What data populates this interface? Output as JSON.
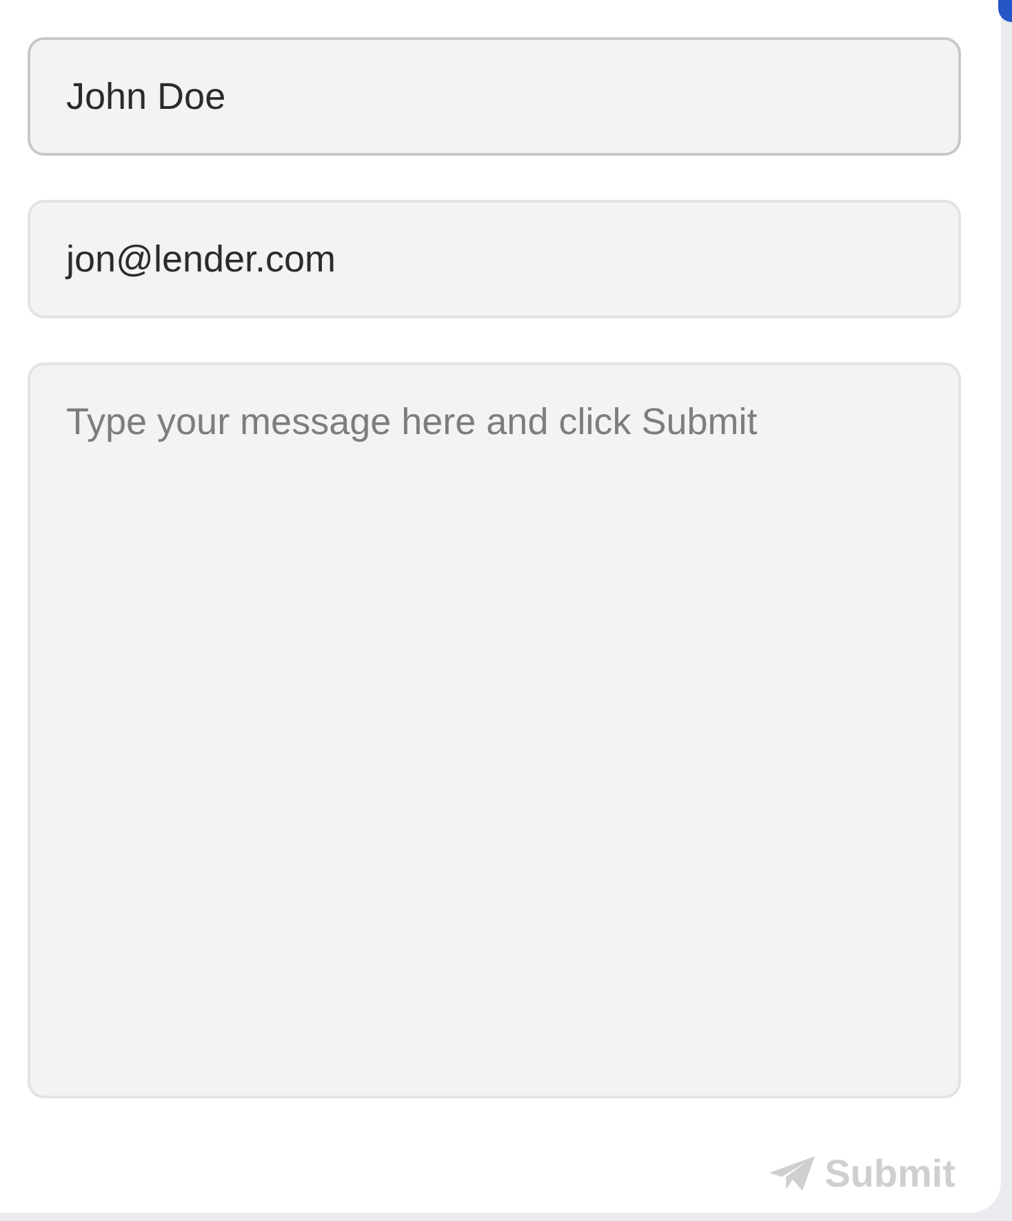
{
  "form": {
    "name_field": {
      "value": "John Doe",
      "focused": true
    },
    "email_field": {
      "value": "jon@lender.com",
      "focused": false
    },
    "message_field": {
      "placeholder": "Type your message here and click Submit"
    },
    "submit_button": {
      "label": "Submit",
      "disabled": true
    }
  }
}
